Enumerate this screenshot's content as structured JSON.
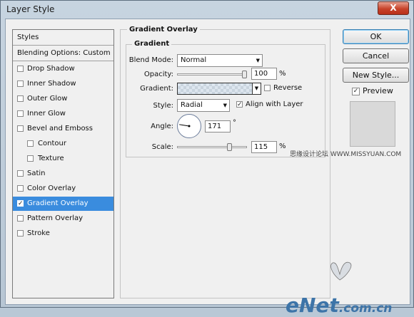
{
  "window": {
    "title": "Layer Style",
    "close_label": "X"
  },
  "styles": {
    "header": "Styles",
    "blending_options": "Blending Options: Custom",
    "items": [
      {
        "label": "Drop Shadow",
        "checked": false,
        "indent": false,
        "selected": false
      },
      {
        "label": "Inner Shadow",
        "checked": false,
        "indent": false,
        "selected": false
      },
      {
        "label": "Outer Glow",
        "checked": false,
        "indent": false,
        "selected": false
      },
      {
        "label": "Inner Glow",
        "checked": false,
        "indent": false,
        "selected": false
      },
      {
        "label": "Bevel and Emboss",
        "checked": false,
        "indent": false,
        "selected": false
      },
      {
        "label": "Contour",
        "checked": false,
        "indent": true,
        "selected": false
      },
      {
        "label": "Texture",
        "checked": false,
        "indent": true,
        "selected": false
      },
      {
        "label": "Satin",
        "checked": false,
        "indent": false,
        "selected": false
      },
      {
        "label": "Color Overlay",
        "checked": false,
        "indent": false,
        "selected": false
      },
      {
        "label": "Gradient Overlay",
        "checked": true,
        "indent": false,
        "selected": true
      },
      {
        "label": "Pattern Overlay",
        "checked": false,
        "indent": false,
        "selected": false
      },
      {
        "label": "Stroke",
        "checked": false,
        "indent": false,
        "selected": false
      }
    ]
  },
  "panel": {
    "title": "Gradient Overlay",
    "group_title": "Gradient",
    "blend_mode_label": "Blend Mode:",
    "blend_mode_value": "Normal",
    "opacity_label": "Opacity:",
    "opacity_value": "100",
    "opacity_fraction": 1.0,
    "percent": "%",
    "gradient_label": "Gradient:",
    "reverse_label": "Reverse",
    "reverse_checked": false,
    "style_label": "Style:",
    "style_value": "Radial",
    "align_label": "Align with Layer",
    "align_checked": true,
    "angle_label": "Angle:",
    "angle_value": "171",
    "angle_unit": "°",
    "scale_label": "Scale:",
    "scale_value": "115",
    "scale_fraction": 0.77
  },
  "buttons": {
    "ok": "OK",
    "cancel": "Cancel",
    "new_style": "New Style..."
  },
  "preview": {
    "label": "Preview",
    "checked": true
  },
  "watermarks": {
    "site": "思缘设计论坛 WWW.MISSYUAN.COM",
    "brand_e": "e",
    "brand_net": "Net",
    "brand_suffix": ".com.cn"
  },
  "colors": {
    "selection": "#3a8cde",
    "close": "#c7432a"
  }
}
